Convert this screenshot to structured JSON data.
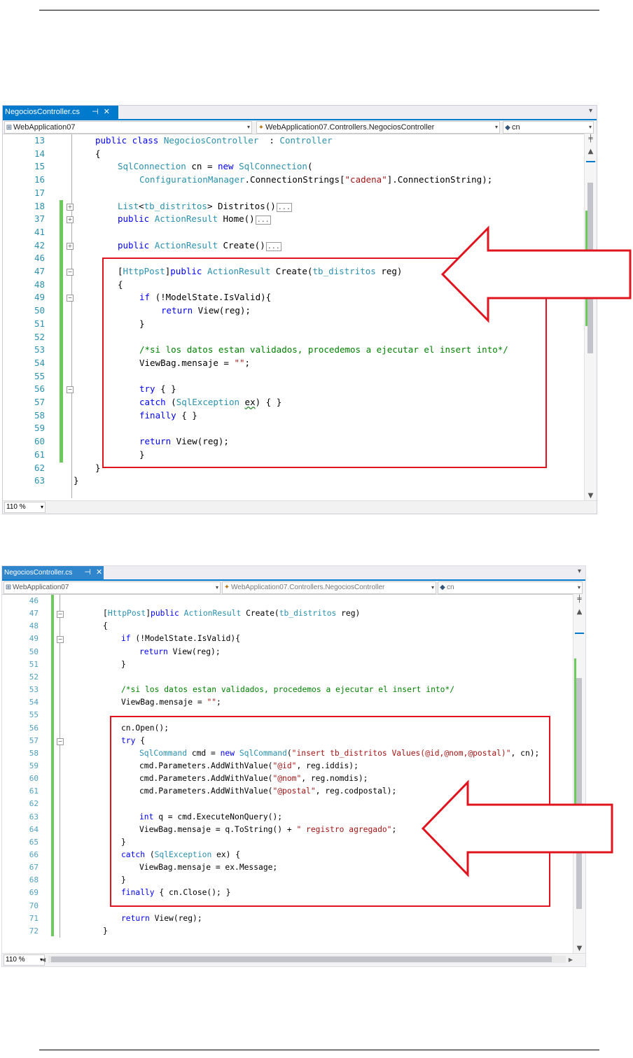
{
  "screenshots": [
    {
      "tab_title": "NegociosController.cs",
      "tab_pin": "⊣",
      "tab_close": "✕",
      "project_combo": "WebApplication07",
      "class_combo": "WebApplication07.Controllers.NegociosController",
      "member_combo": "cn",
      "zoom": "110 %",
      "lines": [
        {
          "n": "13",
          "t": [
            [
              "kw",
              "public class "
            ],
            [
              "ty",
              "NegociosController"
            ],
            [
              "",
              "  : "
            ],
            [
              "ty",
              "Controller"
            ]
          ]
        },
        {
          "n": "14",
          "t": [
            [
              "",
              "{"
            ]
          ]
        },
        {
          "n": "15",
          "t": [
            [
              "ty",
              "SqlConnection"
            ],
            [
              "",
              " cn = "
            ],
            [
              "kw",
              "new "
            ],
            [
              "ty",
              "SqlConnection"
            ],
            [
              "",
              "("
            ]
          ]
        },
        {
          "n": "16",
          "t": [
            [
              "ty",
              "ConfigurationManager"
            ],
            [
              "",
              ".ConnectionStrings["
            ],
            [
              "str",
              "\"cadena\""
            ],
            [
              "",
              "].ConnectionString);"
            ]
          ]
        },
        {
          "n": "17",
          "t": []
        },
        {
          "n": "18",
          "t": [
            [
              "ty",
              "List"
            ],
            [
              "",
              "<"
            ],
            [
              "ty",
              "tb_distritos"
            ],
            [
              "",
              "> Distritos()"
            ]
          ],
          "collapsed": "..."
        },
        {
          "n": "37",
          "t": [
            [
              "kw",
              "public "
            ],
            [
              "ty",
              "ActionResult"
            ],
            [
              "",
              " Home()"
            ]
          ],
          "collapsed": "..."
        },
        {
          "n": "41",
          "t": []
        },
        {
          "n": "42",
          "t": [
            [
              "kw",
              "public "
            ],
            [
              "ty",
              "ActionResult"
            ],
            [
              "",
              " Create()"
            ]
          ],
          "collapsed": "..."
        },
        {
          "n": "46",
          "t": []
        },
        {
          "n": "47",
          "t": [
            [
              "",
              "["
            ],
            [
              "ty",
              "HttpPost"
            ],
            [
              "",
              "]"
            ],
            [
              "kw",
              "public "
            ],
            [
              "ty",
              "ActionResult"
            ],
            [
              "",
              " Create("
            ],
            [
              "ty",
              "tb_distritos"
            ],
            [
              "",
              " reg)"
            ]
          ]
        },
        {
          "n": "48",
          "t": [
            [
              "",
              "{"
            ]
          ]
        },
        {
          "n": "49",
          "t": [
            [
              "kw",
              "if"
            ],
            [
              "",
              " (!ModelState.IsValid){"
            ]
          ]
        },
        {
          "n": "50",
          "t": [
            [
              "kw",
              "return"
            ],
            [
              "",
              " View(reg);"
            ]
          ]
        },
        {
          "n": "51",
          "t": [
            [
              "",
              "}"
            ]
          ]
        },
        {
          "n": "52",
          "t": []
        },
        {
          "n": "53",
          "t": [
            [
              "cm",
              "/*si los datos estan validados, procedemos a ejecutar el insert into*/"
            ]
          ]
        },
        {
          "n": "54",
          "t": [
            [
              "",
              "ViewBag.mensaje = "
            ],
            [
              "str",
              "\"\""
            ],
            [
              "",
              ";"
            ]
          ]
        },
        {
          "n": "55",
          "t": []
        },
        {
          "n": "56",
          "t": [
            [
              "kw",
              "try"
            ],
            [
              "",
              " { }"
            ]
          ]
        },
        {
          "n": "57",
          "t": [
            [
              "kw",
              "catch"
            ],
            [
              "",
              " ("
            ],
            [
              "ty",
              "SqlException"
            ],
            [
              "",
              " "
            ],
            [
              "sq",
              "ex"
            ],
            [
              "",
              ") { }"
            ]
          ]
        },
        {
          "n": "58",
          "t": [
            [
              "kw",
              "finally"
            ],
            [
              "",
              " { }"
            ]
          ]
        },
        {
          "n": "59",
          "t": []
        },
        {
          "n": "60",
          "t": [
            [
              "kw",
              "return"
            ],
            [
              "",
              " View(reg);"
            ]
          ]
        },
        {
          "n": "61",
          "t": [
            [
              "",
              "}"
            ]
          ]
        },
        {
          "n": "62",
          "t": [
            [
              "",
              "}"
            ]
          ]
        },
        {
          "n": "63",
          "t": [
            [
              "",
              "}"
            ]
          ]
        }
      ]
    },
    {
      "tab_title": "NegociosController.cs",
      "tab_pin": "⊣",
      "tab_close": "✕",
      "project_combo": "WebApplication07",
      "class_combo": "WebApplication07.Controllers.NegociosController",
      "member_combo": "cn",
      "zoom": "110 %",
      "lines": [
        {
          "n": "46",
          "t": []
        },
        {
          "n": "47",
          "t": [
            [
              "",
              "["
            ],
            [
              "ty",
              "HttpPost"
            ],
            [
              "",
              "]"
            ],
            [
              "kw",
              "public "
            ],
            [
              "ty",
              "ActionResult"
            ],
            [
              "",
              " Create("
            ],
            [
              "ty",
              "tb_distritos"
            ],
            [
              "",
              " reg)"
            ]
          ]
        },
        {
          "n": "48",
          "t": [
            [
              "",
              "{"
            ]
          ]
        },
        {
          "n": "49",
          "t": [
            [
              "kw",
              "if"
            ],
            [
              "",
              " (!ModelState.IsValid){"
            ]
          ]
        },
        {
          "n": "50",
          "t": [
            [
              "kw",
              "return"
            ],
            [
              "",
              " View(reg);"
            ]
          ]
        },
        {
          "n": "51",
          "t": [
            [
              "",
              "}"
            ]
          ]
        },
        {
          "n": "52",
          "t": []
        },
        {
          "n": "53",
          "t": [
            [
              "cm",
              "/*si los datos estan validados, procedemos a ejecutar el insert into*/"
            ]
          ]
        },
        {
          "n": "54",
          "t": [
            [
              "",
              "ViewBag.mensaje = "
            ],
            [
              "str",
              "\"\""
            ],
            [
              "",
              ";"
            ]
          ]
        },
        {
          "n": "55",
          "t": []
        },
        {
          "n": "56",
          "t": [
            [
              "",
              "cn.Open();"
            ]
          ]
        },
        {
          "n": "57",
          "t": [
            [
              "kw",
              "try"
            ],
            [
              "",
              " {"
            ]
          ]
        },
        {
          "n": "58",
          "t": [
            [
              "ty",
              "SqlCommand"
            ],
            [
              "",
              " cmd = "
            ],
            [
              "kw",
              "new "
            ],
            [
              "ty",
              "SqlCommand"
            ],
            [
              "",
              "("
            ],
            [
              "str",
              "\"insert tb_distritos Values(@id,@nom,@postal)\""
            ],
            [
              "",
              ", cn);"
            ]
          ]
        },
        {
          "n": "59",
          "t": [
            [
              "",
              "cmd.Parameters.AddWithValue("
            ],
            [
              "str",
              "\"@id\""
            ],
            [
              "",
              ", reg.iddis);"
            ]
          ]
        },
        {
          "n": "60",
          "t": [
            [
              "",
              "cmd.Parameters.AddWithValue("
            ],
            [
              "str",
              "\"@nom\""
            ],
            [
              "",
              ", reg.nomdis);"
            ]
          ]
        },
        {
          "n": "61",
          "t": [
            [
              "",
              "cmd.Parameters.AddWithValue("
            ],
            [
              "str",
              "\"@postal\""
            ],
            [
              "",
              ", reg.codpostal);"
            ]
          ]
        },
        {
          "n": "62",
          "t": []
        },
        {
          "n": "63",
          "t": [
            [
              "kw",
              "int"
            ],
            [
              "",
              " q = cmd.ExecuteNonQuery();"
            ]
          ]
        },
        {
          "n": "64",
          "t": [
            [
              "",
              "ViewBag.mensaje = q.ToString() + "
            ],
            [
              "str",
              "\" registro agregado\""
            ],
            [
              "",
              ";"
            ]
          ]
        },
        {
          "n": "65",
          "t": [
            [
              "",
              "}"
            ]
          ]
        },
        {
          "n": "66",
          "t": [
            [
              "kw",
              "catch"
            ],
            [
              "",
              " ("
            ],
            [
              "ty",
              "SqlException"
            ],
            [
              "",
              " ex) {"
            ]
          ]
        },
        {
          "n": "67",
          "t": [
            [
              "",
              "ViewBag.mensaje = ex.Message;"
            ]
          ]
        },
        {
          "n": "68",
          "t": [
            [
              "",
              "}"
            ]
          ]
        },
        {
          "n": "69",
          "t": [
            [
              "kw",
              "finally"
            ],
            [
              "",
              " { cn.Close(); }"
            ]
          ]
        },
        {
          "n": "70",
          "t": []
        },
        {
          "n": "71",
          "t": [
            [
              "kw",
              "return"
            ],
            [
              "",
              " View(reg);"
            ]
          ]
        },
        {
          "n": "72",
          "t": [
            [
              "",
              "}"
            ]
          ]
        }
      ]
    }
  ],
  "colors": {
    "keyword": "#0000ff",
    "type": "#2b91af",
    "string": "#a31515",
    "comment": "#008000",
    "highlight": "#e0141e",
    "tab": "#007acc",
    "change_bar": "#6cca5c"
  }
}
